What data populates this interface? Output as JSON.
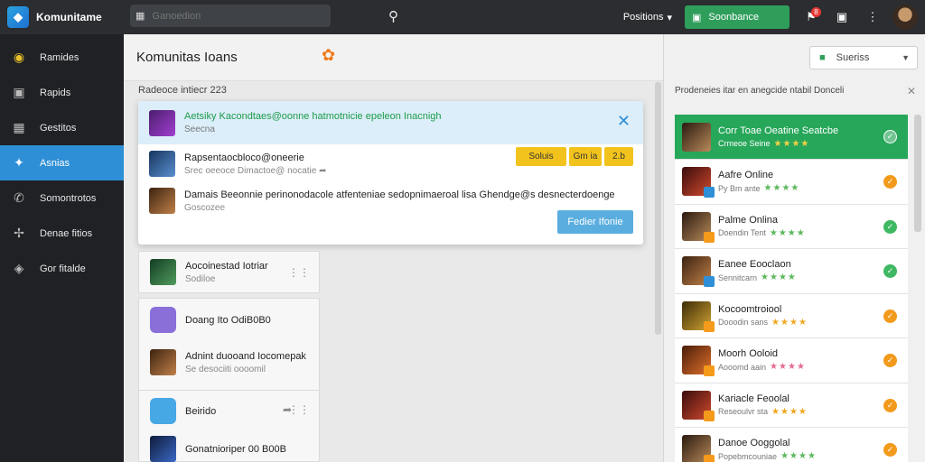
{
  "topbar": {
    "logo_text": "Komunitame",
    "search_placeholder": "Ganoedion",
    "positions_label": "Positions",
    "subscribe_label": "Soonbance",
    "notification_count": "8"
  },
  "sidebar": {
    "items": [
      {
        "label": "Ramides",
        "icon": "radar-icon"
      },
      {
        "label": "Rapids",
        "icon": "tablet-icon"
      },
      {
        "label": "Gestitos",
        "icon": "grid-icon"
      },
      {
        "label": "Asnias",
        "icon": "controller-icon"
      },
      {
        "label": "Somontrotos",
        "icon": "phone-icon"
      },
      {
        "label": "Denae fitios",
        "icon": "puzzle-icon"
      },
      {
        "label": "Gor fitalde",
        "icon": "shield-icon"
      }
    ],
    "active_index": 3
  },
  "main": {
    "title": "Komunitas Ioans",
    "results_count": "Radeoce intiecr 223",
    "popup": {
      "header_title": "Aetsiky Kacondtaes@oonne hatmotnicie epeleon Inacnigh",
      "header_sub": "Seecna",
      "row1_title": "Rapsentaocbloco@oneerie",
      "row1_sub": "Srec oeeoce Dimactoe@ nocatie",
      "row1_actions": [
        "Soluis",
        "Gm ia",
        "2.b"
      ],
      "row2_title": "Damais Beeonnie perinonodacole atfenteniae sedopnimaeroal lisa Ghendge@s desnecterdoenge",
      "row2_sub": "Goscozee",
      "cta_label": "Fedier Ifonie"
    },
    "cards": [
      {
        "title": "Aocoinestad Iotriar",
        "sub": "Sodiloe"
      },
      {
        "title": "Doang Ito OdiB0B0",
        "sub": ""
      },
      {
        "title": "Adnint duooand Iocomepak",
        "sub": "Se desociiti oooomil"
      },
      {
        "title": "Beirido",
        "sub": ""
      },
      {
        "title": "Gonatnioriper 00 B00B",
        "sub": ""
      }
    ]
  },
  "right": {
    "select_value": "Sueriss",
    "header_text": "Prodeneies itar en anegcide ntabil Donceli",
    "items": [
      {
        "title": "Corr Toae Oeatine Seatcbe",
        "meta": "Crmeoe Seine",
        "stars": 4,
        "status": "white",
        "featured": true
      },
      {
        "title": "Aafre Online",
        "meta": "Py Bm ante",
        "stars": 4,
        "status": "orange",
        "featured": false
      },
      {
        "title": "Palme Onlina",
        "meta": "Doendin Tent",
        "stars": 4,
        "status": "green",
        "featured": false
      },
      {
        "title": "Eanee Eooclaon",
        "meta": "Sennitcarn",
        "stars": 4,
        "status": "green",
        "featured": false
      },
      {
        "title": "Kocoomtroiool",
        "meta": "Dooodin sans",
        "stars": 4,
        "status": "orange",
        "featured": false
      },
      {
        "title": "Moorh Ooloid",
        "meta": "Aooomd aain",
        "stars": 4,
        "status": "orange",
        "featured": false
      },
      {
        "title": "Kariacle Feoolal",
        "meta": "Reseoulvr sta",
        "stars": 4,
        "status": "orange",
        "featured": false
      },
      {
        "title": "Danoe Ooggolal",
        "meta": "Popebmcouniae",
        "stars": 4,
        "status": "orange",
        "featured": false
      }
    ]
  },
  "colors": {
    "accent": "#2e8fd6",
    "success": "#2f9e5b",
    "warning": "#f2c31d",
    "orange": "#f29a1c"
  }
}
